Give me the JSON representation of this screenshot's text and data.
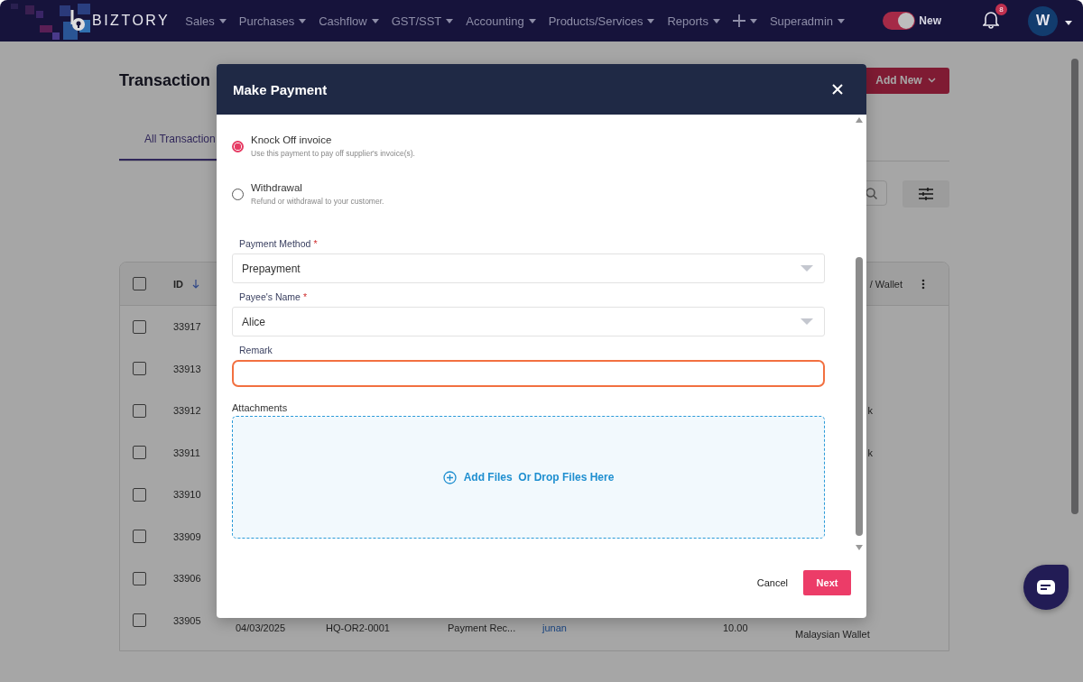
{
  "nav": {
    "logo": "BIZTORY",
    "menu": [
      {
        "kind": "text",
        "label": "Sales"
      },
      {
        "kind": "text",
        "label": "Purchases"
      },
      {
        "kind": "text",
        "label": "Cashflow"
      },
      {
        "kind": "text",
        "label": "GST/SST"
      },
      {
        "kind": "text",
        "label": "Accounting"
      },
      {
        "kind": "text",
        "label": "Products/Services"
      },
      {
        "kind": "text",
        "label": "Reports"
      },
      {
        "kind": "plus"
      },
      {
        "kind": "text",
        "label": "Superadmin"
      }
    ],
    "toggle": {
      "on": true,
      "label": "New"
    },
    "notifications": "8",
    "avatar": "W"
  },
  "page": {
    "title": "Transaction",
    "add_button": "Add New",
    "tabs": [
      {
        "label": "All Transaction",
        "selected": true
      }
    ],
    "table": {
      "columns": [
        "ID",
        "/ Wallet"
      ],
      "select_all_checked": false,
      "rows": [
        {
          "checked": false,
          "id": "33917"
        },
        {
          "checked": false,
          "id": "33913"
        },
        {
          "checked": false,
          "id": "33912",
          "wallet": "k"
        },
        {
          "checked": false,
          "id": "33911",
          "wallet": "k"
        },
        {
          "checked": false,
          "id": "33910"
        },
        {
          "checked": false,
          "id": "33909"
        },
        {
          "checked": false,
          "id": "33906"
        },
        {
          "checked": false,
          "id": "33905",
          "date": "04/03/2025",
          "ref": "HQ-OR2-0001",
          "type": "Payment Rec...",
          "name": "junan",
          "amount": "10.00",
          "wallet": "Malaysian Wallet"
        }
      ]
    }
  },
  "modal": {
    "title": "Make Payment",
    "options": [
      {
        "label": "Knock Off invoice",
        "hint": "Use this payment to pay off supplier's invoice(s).",
        "selected": true
      },
      {
        "label": "Withdrawal",
        "hint": "Refund or withdrawal to your customer.",
        "selected": false
      }
    ],
    "fields": [
      {
        "kind": "select",
        "label": "Payment Method",
        "required_mark": "*",
        "value": "Prepayment",
        "focused": false
      },
      {
        "kind": "select",
        "label": "Payee's Name",
        "required_mark": "*",
        "value": "Alice",
        "focused": false
      },
      {
        "kind": "text",
        "label": "Remark",
        "focused": true
      }
    ],
    "attachments": {
      "label": "Attachments",
      "action": "Add Files  Or Drop Files Here"
    },
    "buttons": [
      {
        "kind": "secondary",
        "label": "Cancel"
      },
      {
        "kind": "primary",
        "label": "Next"
      }
    ]
  }
}
